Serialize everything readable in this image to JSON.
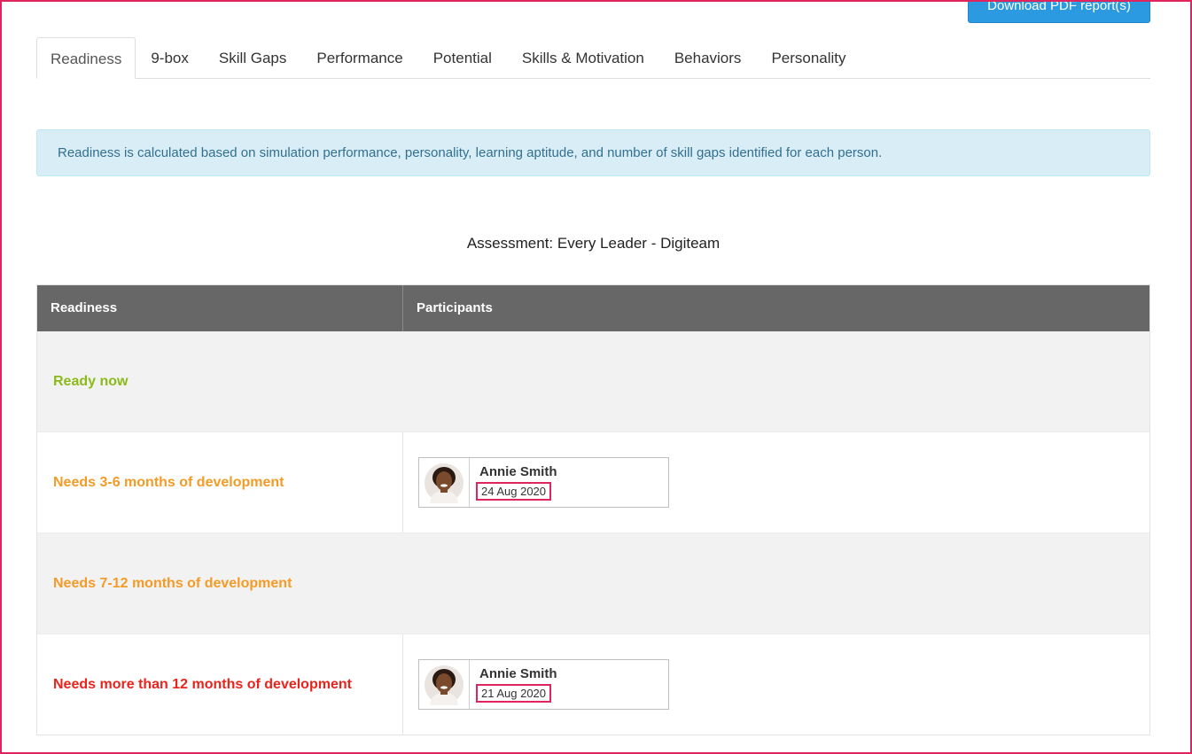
{
  "toolbar": {
    "download_label": "Download PDF report(s)"
  },
  "tabs": [
    {
      "label": "Readiness",
      "active": true
    },
    {
      "label": "9-box"
    },
    {
      "label": "Skill Gaps"
    },
    {
      "label": "Performance"
    },
    {
      "label": "Potential"
    },
    {
      "label": "Skills & Motivation"
    },
    {
      "label": "Behaviors"
    },
    {
      "label": "Personality"
    }
  ],
  "info_text": "Readiness is calculated based on simulation performance, personality, learning aptitude, and number of skill gaps identified for each person.",
  "assessment": "Assessment: Every Leader - Digiteam",
  "table": {
    "headers": [
      "Readiness",
      "Participants"
    ],
    "rows": [
      {
        "label": "Ready now",
        "color": "#8cba1a",
        "participant": null
      },
      {
        "label": "Needs 3-6 months of development",
        "color": "#f29b27",
        "participant": {
          "name": "Annie Smith",
          "date": "24 Aug 2020",
          "avatar": "person-avatar-icon"
        }
      },
      {
        "label": "Needs 7-12 months of development",
        "color": "#f29b27",
        "participant": null
      },
      {
        "label": "Needs more than 12 months of development",
        "color": "#e8241c",
        "participant": {
          "name": "Annie Smith",
          "date": "21 Aug 2020",
          "avatar": "person-avatar-icon"
        }
      }
    ]
  },
  "colors": {
    "accent": "#2b9ae0",
    "highlight": "#e0245e",
    "header_bg": "#676767",
    "info_bg": "#d9edf7"
  }
}
